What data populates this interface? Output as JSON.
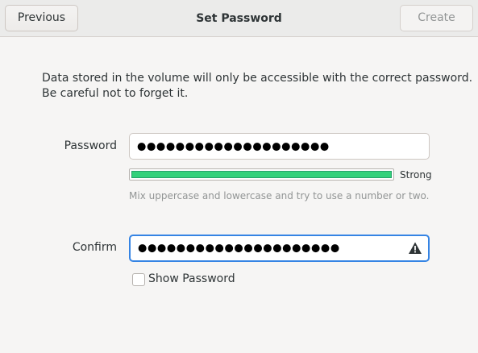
{
  "header": {
    "previous_label": "Previous",
    "title": "Set Password",
    "create_label": "Create"
  },
  "description": {
    "line1": "Data stored in the volume will only be accessible with the correct password.",
    "line2": "Be careful not to forget it."
  },
  "password": {
    "label": "Password",
    "value": "●●●●●●●●●●●●●●●●●●●●"
  },
  "strength": {
    "level": 1.0,
    "label": "Strong",
    "color": "#33d17a",
    "hint": "Mix uppercase and lowercase and try to use a number or two."
  },
  "confirm": {
    "label": "Confirm",
    "value": "●●●●●●●●●●●●●●●●●●●●●",
    "warning_icon": "warning-icon"
  },
  "show_password": {
    "label": "Show Password",
    "checked": false
  }
}
